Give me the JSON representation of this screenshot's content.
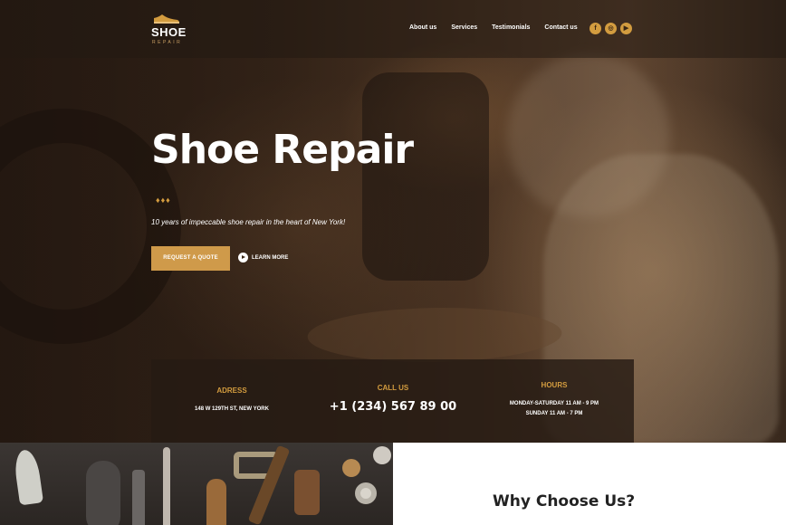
{
  "header": {
    "logo": {
      "text": "SHOE",
      "subtext": "REPAIR"
    },
    "nav": [
      "About us",
      "Services",
      "Testimonials",
      "Contact us"
    ],
    "socials": [
      {
        "name": "facebook-icon",
        "glyph": "f"
      },
      {
        "name": "instagram-icon",
        "glyph": "◎"
      },
      {
        "name": "youtube-icon",
        "glyph": "▶"
      }
    ]
  },
  "hero": {
    "title": "Shoe Repair",
    "diamonds": "♦♦♦",
    "subtitle": "10 years of impeccable shoe repair in the heart of New York!",
    "cta_primary": "REQUEST A QUOTE",
    "cta_secondary": "LEARN MORE"
  },
  "info": {
    "address": {
      "heading": "ADRESS",
      "value": "148 W 129TH ST, NEW YORK"
    },
    "call": {
      "heading": "CALL US",
      "value": "+1 (234) 567 89 00"
    },
    "hours": {
      "heading": "HOURS",
      "line1": "MONDAY-SATURDAY 11 AM - 9 PM",
      "line2": "SUNDAY 11 AM - 7 PM"
    }
  },
  "section": {
    "title": "Why Choose Us?"
  },
  "colors": {
    "accent": "#cf9a4a",
    "dark": "#2a1d14"
  }
}
